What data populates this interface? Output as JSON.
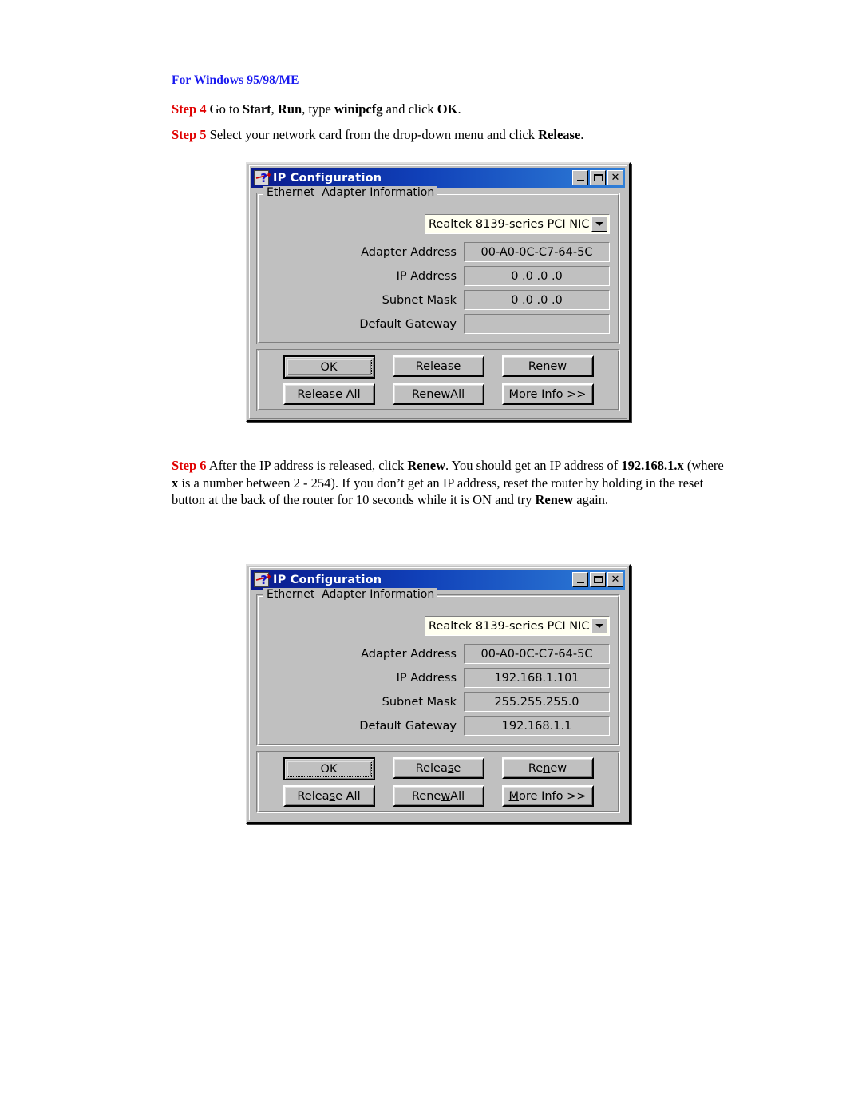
{
  "document": {
    "heading": "For Windows 95/98/ME",
    "steps": [
      {
        "label": "Step 4",
        "segments": [
          {
            "text": " Go to ",
            "bold": false
          },
          {
            "text": "Start",
            "bold": true
          },
          {
            "text": ", ",
            "bold": false
          },
          {
            "text": "Run",
            "bold": true
          },
          {
            "text": ", type ",
            "bold": false
          },
          {
            "text": "winipcfg",
            "bold": true
          },
          {
            "text": " and click ",
            "bold": false
          },
          {
            "text": "OK",
            "bold": true
          },
          {
            "text": ".",
            "bold": false
          }
        ]
      },
      {
        "label": "Step 5",
        "segments": [
          {
            "text": " Select your network card from the drop-down menu and click ",
            "bold": false
          },
          {
            "text": "Release",
            "bold": true
          },
          {
            "text": ".",
            "bold": false
          }
        ]
      },
      {
        "label": "Step 6",
        "segments": [
          {
            "text": " After the IP address is released, click ",
            "bold": false
          },
          {
            "text": "Renew",
            "bold": true
          },
          {
            "text": ". You should get an IP address of ",
            "bold": false
          },
          {
            "text": "192.168.1.x",
            "bold": true
          },
          {
            "text": " (where ",
            "bold": false
          },
          {
            "text": "x",
            "bold": true
          },
          {
            "text": " is a number between 2 - 254). If you don’t get an IP address, reset the router by holding in the reset button at the back of the router for 10 seconds while it is ON and try ",
            "bold": false
          },
          {
            "text": "Renew",
            "bold": true
          },
          {
            "text": " again.",
            "bold": false
          }
        ]
      }
    ]
  },
  "dialog_common": {
    "title": "IP Configuration",
    "title_icon": "help-arrow-icon",
    "minimize_label": "Minimize",
    "maximize_label": "Maximize",
    "close_label": "Close",
    "close_glyph": "✕",
    "group_label": "Ethernet  Adapter Information",
    "adapter_select_value": "Realtek 8139-series PCI NIC",
    "dropdown_icon": "chevron-down-icon",
    "field_labels": {
      "adapter_address": "Adapter Address",
      "ip_address": "IP Address",
      "subnet_mask": "Subnet Mask",
      "default_gateway": "Default Gateway"
    },
    "buttons": {
      "ok": {
        "before": "",
        "accel": "",
        "after": "OK"
      },
      "release": {
        "before": "Relea",
        "accel": "s",
        "after": "e"
      },
      "renew": {
        "before": "Re",
        "accel": "n",
        "after": "ew"
      },
      "release_all": {
        "before": "Relea",
        "accel": "s",
        "after": "e All"
      },
      "renew_all": {
        "before": "Rene",
        "accel": "w",
        "after": " All"
      },
      "more_info": {
        "before": "",
        "accel": "M",
        "after": "ore Info >>"
      }
    },
    "colors": {
      "title_gradient_start": "#0a1a8c",
      "title_gradient_end": "#2f7fd8",
      "dialog_face": "#c0c0c0",
      "combo_field": "#fffff0",
      "step_label": "#e00000",
      "heading": "#1a1af0"
    }
  },
  "dialog_released": {
    "adapter_address": "00-A0-0C-C7-64-5C",
    "ip_address": "0 .0 .0 .0",
    "subnet_mask": "0 .0 .0 .0",
    "default_gateway": ""
  },
  "dialog_renewed": {
    "adapter_address": "00-A0-0C-C7-64-5C",
    "ip_address": "192.168.1.101",
    "subnet_mask": "255.255.255.0",
    "default_gateway": "192.168.1.1"
  }
}
